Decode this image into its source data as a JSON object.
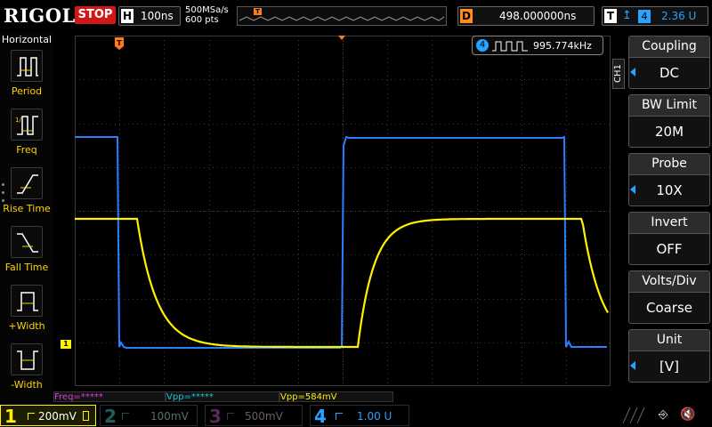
{
  "brand": "RIGOL",
  "run_state": "STOP",
  "timebase": {
    "letter": "H",
    "value": "100ns"
  },
  "sampling": {
    "rate": "500MSa/s",
    "points": "600 pts"
  },
  "delay": {
    "letter": "D",
    "value": "498.000000ns"
  },
  "trigger": {
    "letter": "T",
    "edge_symbol": "↥",
    "source": "4",
    "level": "2.36 U"
  },
  "left_menu": {
    "title": "Horizontal",
    "items": [
      {
        "label": "Period",
        "icon": "period-icon"
      },
      {
        "label": "Freq",
        "icon": "freq-icon"
      },
      {
        "label": "Rise Time",
        "icon": "rise-time-icon"
      },
      {
        "label": "Fall Time",
        "icon": "fall-time-icon"
      },
      {
        "label": "+Width",
        "icon": "positive-width-icon"
      },
      {
        "label": "-Width",
        "icon": "negative-width-icon"
      }
    ]
  },
  "freq_counter": {
    "channel": "4",
    "value": "995.774kHz"
  },
  "right_menu": {
    "channel_tab": "CH1",
    "items": [
      {
        "title": "Coupling",
        "value": "DC",
        "has_arrow": true
      },
      {
        "title": "BW Limit",
        "value": "20M",
        "has_arrow": false
      },
      {
        "title": "Probe",
        "value": "10X",
        "has_arrow": true
      },
      {
        "title": "Invert",
        "value": "OFF",
        "has_arrow": false
      },
      {
        "title": "Volts/Div",
        "value": "Coarse",
        "has_arrow": false
      },
      {
        "title": "Unit",
        "value": "[V]",
        "has_arrow": true
      }
    ]
  },
  "measurements": {
    "freq": "Freq=*****",
    "vpp_ch4": "Vpp=*****",
    "vpp_ch1": "Vpp=584mV"
  },
  "channels": [
    {
      "number": "1",
      "scale": "200mV",
      "active": true
    },
    {
      "number": "2",
      "scale": "100mV",
      "active": false
    },
    {
      "number": "3",
      "scale": "500mV",
      "active": false
    },
    {
      "number": "4",
      "scale": "1.00 U",
      "active": true
    }
  ],
  "markers": {
    "ch1_ground": "1",
    "trigger_level": "T",
    "trigger_pos": "T"
  },
  "colors": {
    "ch1": "#fff200",
    "ch4": "#2a7fff",
    "grid": "#3a3a3a",
    "trigger": "#ff7a1a",
    "accent": "#2aa2ff"
  }
}
